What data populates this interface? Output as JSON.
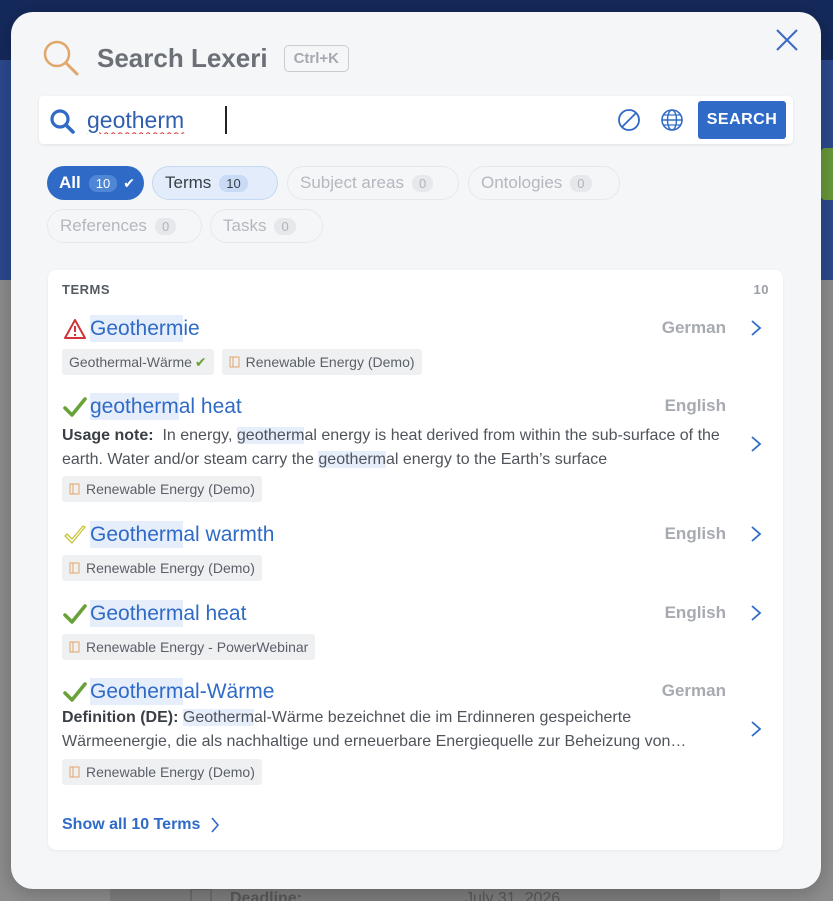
{
  "background": {
    "deadline_label": "Deadline:",
    "deadline_value": "July 31, 2026"
  },
  "modal": {
    "title": "Search Lexeri",
    "shortcut": "Ctrl+K"
  },
  "search": {
    "value": "geotherm",
    "button_label": "SEARCH"
  },
  "filters": [
    {
      "label": "All",
      "count": "10",
      "state": "active"
    },
    {
      "label": "Terms",
      "count": "10",
      "state": "secondary"
    },
    {
      "label": "Subject areas",
      "count": "0",
      "state": "disabled"
    },
    {
      "label": "Ontologies",
      "count": "0",
      "state": "disabled"
    },
    {
      "label": "References",
      "count": "0",
      "state": "disabled"
    },
    {
      "label": "Tasks",
      "count": "0",
      "state": "disabled"
    }
  ],
  "results": {
    "section_label": "TERMS",
    "section_count": "10",
    "items": [
      {
        "title_hl": "Geotherm",
        "title_rest": "ie",
        "status": "warning",
        "language": "German",
        "tags": [
          "Geothermal-Wärme",
          "Renewable Energy (Demo)"
        ]
      },
      {
        "title_hl": "geotherm",
        "title_rest": "al heat",
        "status": "approved",
        "language": "English",
        "desc_label": "Usage note:",
        "desc_part1": "In energy, ",
        "desc_hl1": "geotherm",
        "desc_part2": "al energy is heat derived from within the sub-surface of the earth. Water and/or steam carry the ",
        "desc_hl2": "geotherm",
        "desc_part3": "al energy to the Earth’s surface",
        "tags": [
          "Renewable Energy (Demo)"
        ]
      },
      {
        "title_hl": "Geotherm",
        "title_rest": "al warmth",
        "status": "pending",
        "language": "English",
        "tags": [
          "Renewable Energy (Demo)"
        ]
      },
      {
        "title_hl": "Geotherm",
        "title_rest": "al heat",
        "status": "approved",
        "language": "English",
        "tags": [
          "Renewable Energy - PowerWebinar"
        ]
      },
      {
        "title_hl": "Geotherm",
        "title_rest": "al-Wärme",
        "status": "approved",
        "language": "German",
        "desc_label": "Definition (DE):",
        "desc_hl1": "Geotherm",
        "desc_part2": "al-Wärme bezeichnet die im Erdinneren gespeicherte Wärmeenergie, die als nachhaltige und erneuerbare Energiequelle zur Beheizung von…",
        "tags": [
          "Renewable Energy (Demo)"
        ]
      }
    ],
    "show_all": "Show all 10 Terms"
  },
  "colors": {
    "accent": "#2f6bc6",
    "approved": "#6aa23a",
    "pending": "#c9c43a",
    "warning": "#d0343a",
    "highlight": "#e6eefb"
  }
}
